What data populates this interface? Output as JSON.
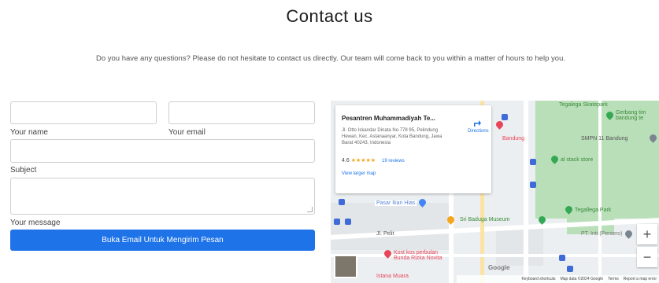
{
  "header": {
    "title": "Contact us",
    "subtitle": "Do you have any questions? Please do not hesitate to contact us directly. Our team will come back to you within a matter of hours to help you."
  },
  "form": {
    "name_label": "Your name",
    "email_label": "Your email",
    "subject_label": "Subject",
    "message_label": "Your message",
    "submit_label": "Buka Email Untuk Mengirim Pesan"
  },
  "map": {
    "place_title": "Pesantren Muhammadiyah Te...",
    "address": "Jl. Otto Iskandar Dinata No.778 95, Pelindung Hewan, Kec. Astanaanyar, Kota Bandung, Jawa Barat 40243, Indonesia",
    "rating": "4.6",
    "stars": "★★★★★",
    "reviews": "19 reviews",
    "larger_map": "View larger map",
    "directions": "Directions",
    "labels": {
      "tegalega_skatepark": "Tegalega Skatepark",
      "gerbang": "Gerbang tim bandung te",
      "bandung": "Bandung",
      "smpn": "SMPN 11 Bandung",
      "stock_store": "al stack store",
      "pasar_ikan": "Pasar Ikan Hias",
      "sri_baduga": "Sri Baduga Museum",
      "tegallega_park": "Tegallega Park",
      "pt_inti": "PT. Inti (Persero)",
      "jl_pelit": "Jl. Pelit",
      "kost": "Kost kos perbulan Bunda Rizka Novita",
      "istana": "Istana Muara",
      "google": "Google"
    },
    "zoom_in": "+",
    "zoom_out": "−",
    "footer": {
      "shortcuts": "Keyboard shortcuts",
      "mapdata": "Map data ©2024 Google",
      "terms": "Terms",
      "report": "Report a map error"
    },
    "colors": {
      "park": "#b9dfb9",
      "accent_blue": "#1e73e8",
      "pin_red": "#e8445a",
      "pin_green": "#34a853"
    }
  }
}
